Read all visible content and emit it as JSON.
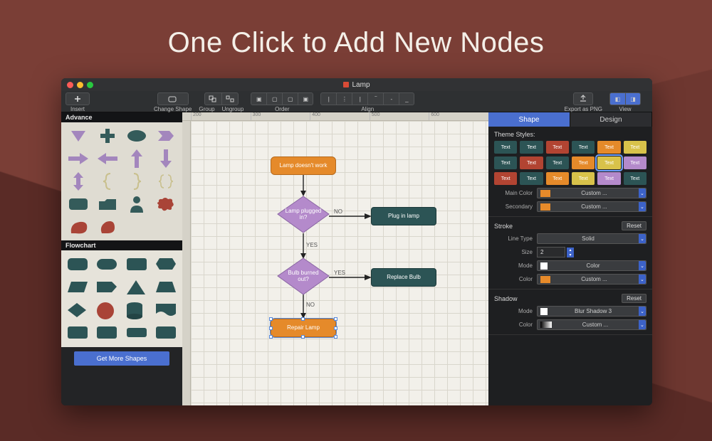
{
  "headline": "One Click to Add New Nodes",
  "window": {
    "title": "Lamp"
  },
  "toolbar": {
    "insert": "Insert",
    "change_shape": "Change Shape",
    "group": "Group",
    "ungroup": "Ungroup",
    "order": "Order",
    "align": "Align",
    "export": "Export as PNG",
    "view": "View"
  },
  "left": {
    "cat_advance": "Advance",
    "cat_flowchart": "Flowchart",
    "get_more": "Get More Shapes"
  },
  "ruler_marks": [
    "200",
    "300",
    "400",
    "500",
    "600"
  ],
  "flowchart": {
    "n1": "Lamp doesn't work",
    "n2": "Lamp plugged in?",
    "n3": "Plug in lamp",
    "n4": "Bulb burned out?",
    "n5": "Replace Bulb",
    "n6": "Repair Lamp",
    "yes": "YES",
    "no": "NO"
  },
  "right": {
    "tab_shape": "Shape",
    "tab_design": "Design",
    "theme_styles": "Theme Styles:",
    "swatch_text": "Text",
    "main_color": "Main Color",
    "secondary": "Secondary",
    "custom": "Custom ...",
    "stroke": "Stroke",
    "reset": "Reset",
    "line_type": "Line Type",
    "solid": "Solid",
    "size": "Size",
    "size_val": "2",
    "mode": "Mode",
    "color": "Color",
    "color_mode": "Color",
    "shadow": "Shadow",
    "shadow_mode": "Blur Shadow 3"
  },
  "swatch_colors": [
    "#2c5455",
    "#2c5455",
    "#b24432",
    "#2c5455",
    "#e58a2a",
    "#d8c24a",
    "#2c5455",
    "#b24432",
    "#2c5455",
    "#e58a2a",
    "#d8c24a",
    "#b48acb",
    "#b24432",
    "#2c5455",
    "#e58a2a",
    "#d8c24a",
    "#b48acb",
    "#2c5455"
  ]
}
